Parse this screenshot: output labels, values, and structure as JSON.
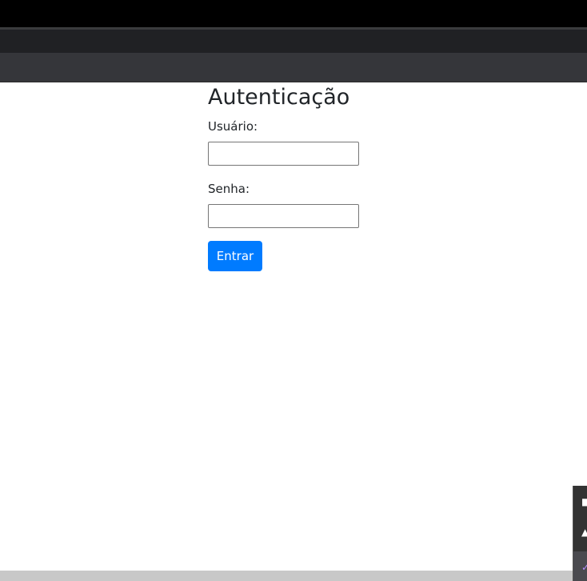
{
  "browser": {
    "top_bar_color": "#000000",
    "tabstrip_color": "#202124",
    "toolbar_color": "#35363a"
  },
  "auth": {
    "title": "Autenticação",
    "username_label": "Usuário:",
    "username_value": "",
    "password_label": "Senha:",
    "password_value": "",
    "submit_label": "Entrar"
  },
  "colors": {
    "primary_button": "#007bff",
    "text": "#212529"
  },
  "side_panel": {
    "icons": [
      "monitor-icon",
      "shield-icon",
      "feather-icon"
    ]
  }
}
